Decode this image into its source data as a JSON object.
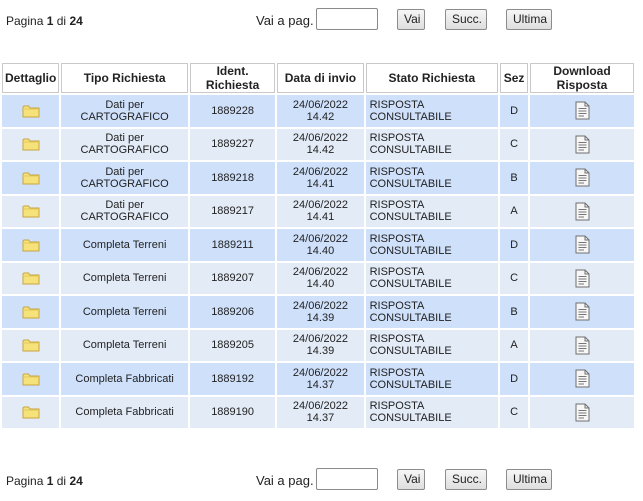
{
  "pager": {
    "page_prefix": "Pagina",
    "page_current": "1",
    "page_sep": "di",
    "page_total": "24",
    "goto_label": "Vai a pag.",
    "goto_value": "",
    "vai_label": "Vai",
    "succ_label": "Succ.",
    "ultima_label": "Ultima"
  },
  "table": {
    "headers": [
      "Dettaglio",
      "Tipo Richiesta",
      "Ident. Richiesta",
      "Data di invio",
      "Stato Richiesta",
      "Sez",
      "Download Risposta"
    ],
    "rows": [
      {
        "tipo": "Dati per CARTOGRAFICO",
        "ident": "1889228",
        "data": "24/06/2022 14.42",
        "stato": "RISPOSTA CONSULTABILE",
        "sez": "D"
      },
      {
        "tipo": "Dati per CARTOGRAFICO",
        "ident": "1889227",
        "data": "24/06/2022 14.42",
        "stato": "RISPOSTA CONSULTABILE",
        "sez": "C"
      },
      {
        "tipo": "Dati per CARTOGRAFICO",
        "ident": "1889218",
        "data": "24/06/2022 14.41",
        "stato": "RISPOSTA CONSULTABILE",
        "sez": "B"
      },
      {
        "tipo": "Dati per CARTOGRAFICO",
        "ident": "1889217",
        "data": "24/06/2022 14.41",
        "stato": "RISPOSTA CONSULTABILE",
        "sez": "A"
      },
      {
        "tipo": "Completa Terreni",
        "ident": "1889211",
        "data": "24/06/2022 14.40",
        "stato": "RISPOSTA CONSULTABILE",
        "sez": "D"
      },
      {
        "tipo": "Completa Terreni",
        "ident": "1889207",
        "data": "24/06/2022 14.40",
        "stato": "RISPOSTA CONSULTABILE",
        "sez": "C"
      },
      {
        "tipo": "Completa Terreni",
        "ident": "1889206",
        "data": "24/06/2022 14.39",
        "stato": "RISPOSTA CONSULTABILE",
        "sez": "B"
      },
      {
        "tipo": "Completa Terreni",
        "ident": "1889205",
        "data": "24/06/2022 14.39",
        "stato": "RISPOSTA CONSULTABILE",
        "sez": "A"
      },
      {
        "tipo": "Completa Fabbricati",
        "ident": "1889192",
        "data": "24/06/2022 14.37",
        "stato": "RISPOSTA CONSULTABILE",
        "sez": "D"
      },
      {
        "tipo": "Completa Fabbricati",
        "ident": "1889190",
        "data": "24/06/2022 14.37",
        "stato": "RISPOSTA CONSULTABILE",
        "sez": "C"
      }
    ]
  },
  "icons": {
    "detail": "folder-icon",
    "download": "document-icon"
  },
  "colors": {
    "row_odd": "#cfe0fb",
    "row_even": "#e3ebf7",
    "folder": "#f5e27a"
  }
}
